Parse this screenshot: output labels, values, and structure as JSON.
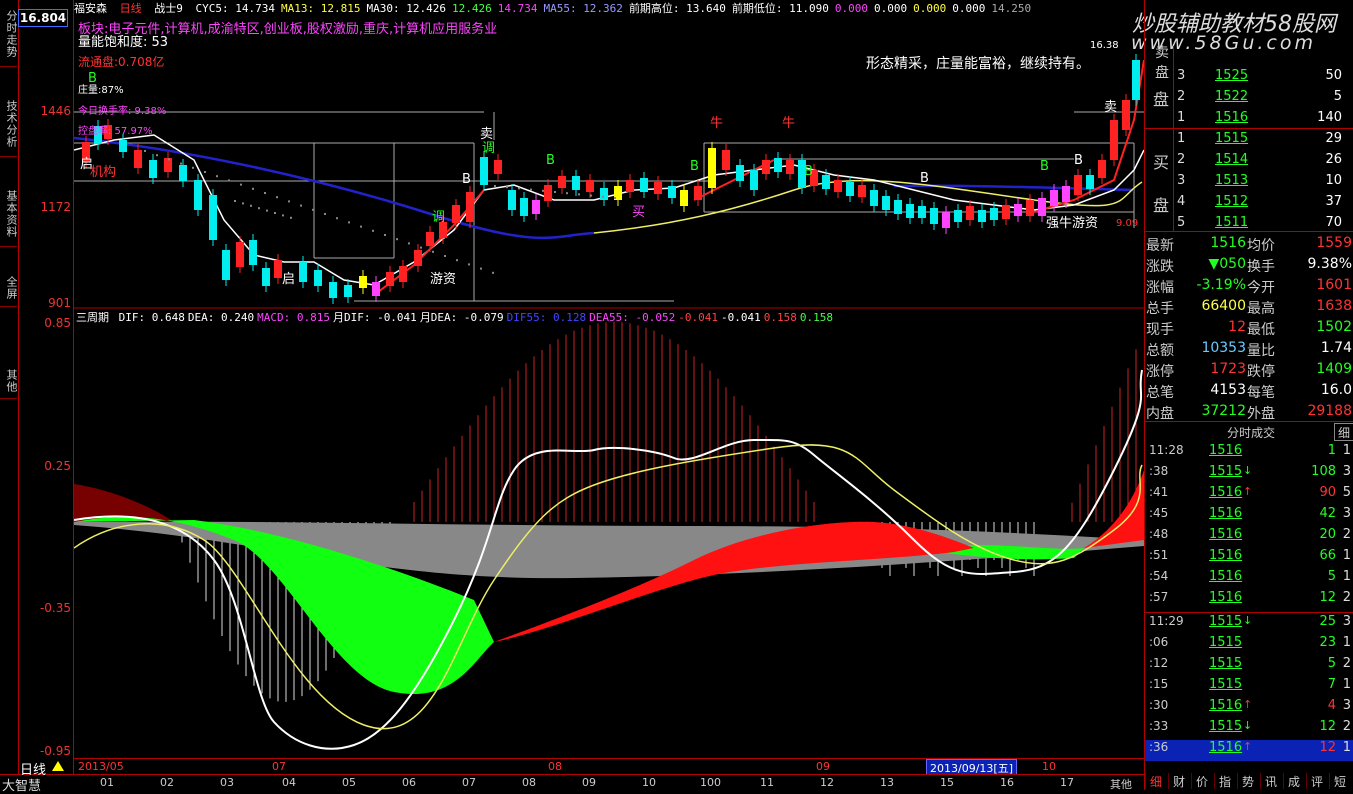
{
  "app": {
    "brand": "大智慧",
    "period": "日线"
  },
  "left_tabs": [
    "分时走势",
    "技术分析",
    "基本资料",
    "全屏",
    "其他"
  ],
  "price_axis": {
    "top_price": "16.804",
    "ticks": [
      "1446",
      "1172",
      "901"
    ]
  },
  "macd_axis": {
    "ticks": [
      "0.85",
      "0.25",
      "-0.35",
      "-0.95"
    ]
  },
  "header": {
    "stock": "福安森",
    "period": "日线",
    "indicator": "战士9",
    "items": [
      {
        "t": "CYC5: 14.734",
        "c": "#fff"
      },
      {
        "t": "MA13: 12.815",
        "c": "#ff4"
      },
      {
        "t": "MA30: 12.426",
        "c": "#fff"
      },
      {
        "t": "12.426",
        "c": "#4f4"
      },
      {
        "t": "14.734",
        "c": "#f4f"
      },
      {
        "t": "MA55: 12.362",
        "c": "#99f"
      },
      {
        "t": "前期高位: 13.640",
        "c": "#fff"
      },
      {
        "t": "前期低位: 11.090",
        "c": "#fff"
      },
      {
        "t": "0.000",
        "c": "#f4f"
      },
      {
        "t": "0.000",
        "c": "#fff"
      },
      {
        "t": "0.000",
        "c": "#ff4"
      },
      {
        "t": "0.000",
        "c": "#fff"
      },
      {
        "t": "14.250",
        "c": "#aaa"
      }
    ]
  },
  "overlay": {
    "sector": "板块:电子元件,计算机,成渝特区,创业板,股权激励,重庆,计算机应用服务业",
    "saturation": "量能饱和度: 53",
    "float": "流通盘:0.708亿",
    "zhuangliang": "庄量:87%",
    "turnover": "今日换手率: 9.38%",
    "kong": "控盘率: 57.97%",
    "comment": "形态精采，庄量能富裕，继续持有。",
    "peak": "16.38",
    "low": "9.09"
  },
  "chart_labels": [
    {
      "t": "B",
      "c": "#2f2"
    },
    {
      "t": "启",
      "c": "#fff"
    },
    {
      "t": "机构",
      "c": "#f33"
    },
    {
      "t": "启",
      "c": "#fff"
    },
    {
      "t": "游资",
      "c": "#fff"
    },
    {
      "t": "卖",
      "c": "#fff"
    },
    {
      "t": "调",
      "c": "#2f2"
    },
    {
      "t": "B",
      "c": "#fff"
    },
    {
      "t": "调",
      "c": "#2f2"
    },
    {
      "t": "B",
      "c": "#2f2"
    },
    {
      "t": "买",
      "c": "#f4f"
    },
    {
      "t": "牛",
      "c": "#f33"
    },
    {
      "t": "B",
      "c": "#2f2"
    },
    {
      "t": "牛",
      "c": "#f33"
    },
    {
      "t": "B",
      "c": "#2f2"
    },
    {
      "t": "B",
      "c": "#fff"
    },
    {
      "t": "B",
      "c": "#2f2"
    },
    {
      "t": "卖",
      "c": "#fff"
    },
    {
      "t": "B",
      "c": "#fff"
    },
    {
      "t": "强牛游资",
      "c": "#fff"
    }
  ],
  "macd_header": {
    "name": "三周期",
    "items": [
      {
        "t": "DIF: 0.648",
        "c": "#fff"
      },
      {
        "t": "DEA: 0.240",
        "c": "#fff"
      },
      {
        "t": "MACD: 0.815",
        "c": "#f4f"
      },
      {
        "t": "月DIF: -0.041",
        "c": "#fff"
      },
      {
        "t": "月DEA: -0.079",
        "c": "#fff"
      },
      {
        "t": "DIF55: 0.128",
        "c": "#44f"
      },
      {
        "t": "DEA55: -0.052",
        "c": "#f4f"
      },
      {
        "t": "-0.041",
        "c": "#f44"
      },
      {
        "t": "-0.041",
        "c": "#fff"
      },
      {
        "t": "0.158",
        "c": "#f44"
      },
      {
        "t": "0.158",
        "c": "#4f4"
      }
    ]
  },
  "date_bar": {
    "left": "2013/05",
    "m07": "07",
    "m08": "08",
    "m09": "09",
    "cursor": "2013/09/13[五]",
    "m10": "10"
  },
  "bottom_nums": [
    "01",
    "02",
    "03",
    "04",
    "05",
    "06",
    "07",
    "08",
    "09",
    "10",
    "100",
    "11",
    "12",
    "13",
    "15",
    "16",
    "17",
    "其他"
  ],
  "orderbook": {
    "sell": [
      {
        "lv": "3",
        "px": "1525",
        "vol": "50"
      },
      {
        "lv": "2",
        "px": "1522",
        "vol": "5"
      },
      {
        "lv": "1",
        "px": "1516",
        "vol": "140"
      }
    ],
    "buy": [
      {
        "lv": "1",
        "px": "1515",
        "vol": "29"
      },
      {
        "lv": "2",
        "px": "1514",
        "vol": "26"
      },
      {
        "lv": "3",
        "px": "1513",
        "vol": "10"
      },
      {
        "lv": "4",
        "px": "1512",
        "vol": "37"
      },
      {
        "lv": "5",
        "px": "1511",
        "vol": "70"
      }
    ],
    "sell_label": "卖盘",
    "sell_label2": "盘",
    "buy_label": "买",
    "buy_label2": "盘"
  },
  "quote": [
    {
      "l": "最新",
      "v": "1516",
      "vc": "#2f2",
      "l2": "均价",
      "v2": "1559",
      "v2c": "#f33"
    },
    {
      "l": "涨跌",
      "v": "▼050",
      "vc": "#2f2",
      "l2": "换手",
      "v2": "9.38%",
      "v2c": "#fff"
    },
    {
      "l": "涨幅",
      "v": "-3.19%",
      "vc": "#2f2",
      "l2": "今开",
      "v2": "1601",
      "v2c": "#f33"
    },
    {
      "l": "总手",
      "v": "66400",
      "vc": "#ff4",
      "l2": "最高",
      "v2": "1638",
      "v2c": "#f33"
    },
    {
      "l": "现手",
      "v": "12",
      "vc": "#f33",
      "l2": "最低",
      "v2": "1502",
      "v2c": "#2f2"
    },
    {
      "l": "总额",
      "v": "10353",
      "vc": "#6cf",
      "l2": "量比",
      "v2": "1.74",
      "v2c": "#fff"
    },
    {
      "l": "涨停",
      "v": "1723",
      "vc": "#f33",
      "l2": "跌停",
      "v2": "1409",
      "v2c": "#2f2"
    },
    {
      "l": "总笔",
      "v": "4153",
      "vc": "#fff",
      "l2": "每笔",
      "v2": "16.0",
      "v2c": "#fff"
    },
    {
      "l": "内盘",
      "v": "37212",
      "vc": "#2f2",
      "l2": "外盘",
      "v2": "29188",
      "v2c": "#f33"
    }
  ],
  "ticks_title": "分时成交",
  "ticks_tab": "细",
  "ticks": [
    {
      "t": "11:28",
      "p": "1516",
      "a": "",
      "v": "1",
      "n": "1",
      "vc": "#2f2"
    },
    {
      "t": ":38",
      "p": "1515",
      "a": "↓",
      "v": "108",
      "n": "3",
      "vc": "#2f2"
    },
    {
      "t": ":41",
      "p": "1516",
      "a": "↑",
      "v": "90",
      "n": "5",
      "vc": "#f33"
    },
    {
      "t": ":45",
      "p": "1516",
      "a": "",
      "v": "42",
      "n": "3",
      "vc": "#2f2"
    },
    {
      "t": ":48",
      "p": "1516",
      "a": "",
      "v": "20",
      "n": "2",
      "vc": "#2f2"
    },
    {
      "t": ":51",
      "p": "1516",
      "a": "",
      "v": "66",
      "n": "1",
      "vc": "#2f2"
    },
    {
      "t": ":54",
      "p": "1516",
      "a": "",
      "v": "5",
      "n": "1",
      "vc": "#2f2"
    },
    {
      "t": ":57",
      "p": "1516",
      "a": "",
      "v": "12",
      "n": "2",
      "vc": "#2f2"
    },
    {
      "t": "11:29",
      "p": "1515",
      "a": "↓",
      "v": "25",
      "n": "3",
      "vc": "#2f2"
    },
    {
      "t": ":06",
      "p": "1515",
      "a": "",
      "v": "23",
      "n": "1",
      "vc": "#2f2"
    },
    {
      "t": ":12",
      "p": "1515",
      "a": "",
      "v": "5",
      "n": "2",
      "vc": "#2f2"
    },
    {
      "t": ":15",
      "p": "1515",
      "a": "",
      "v": "7",
      "n": "1",
      "vc": "#2f2"
    },
    {
      "t": ":30",
      "p": "1516",
      "a": "↑",
      "v": "4",
      "n": "3",
      "vc": "#f33"
    },
    {
      "t": ":33",
      "p": "1515",
      "a": "↓",
      "v": "12",
      "n": "2",
      "vc": "#2f2"
    },
    {
      "t": ":36",
      "p": "1516",
      "a": "↑",
      "v": "12",
      "n": "1",
      "vc": "#f33"
    }
  ],
  "bottom_tabs": [
    "细",
    "财",
    "价",
    "指",
    "势",
    "讯",
    "成",
    "评",
    "短"
  ],
  "watermark": {
    "line1": "炒股辅助教材58股网",
    "line2": "www.58Gu.com"
  },
  "colors": {
    "up": "#ff3333",
    "down": "#22ff22",
    "frame": "#b00000",
    "bg": "#000000"
  }
}
